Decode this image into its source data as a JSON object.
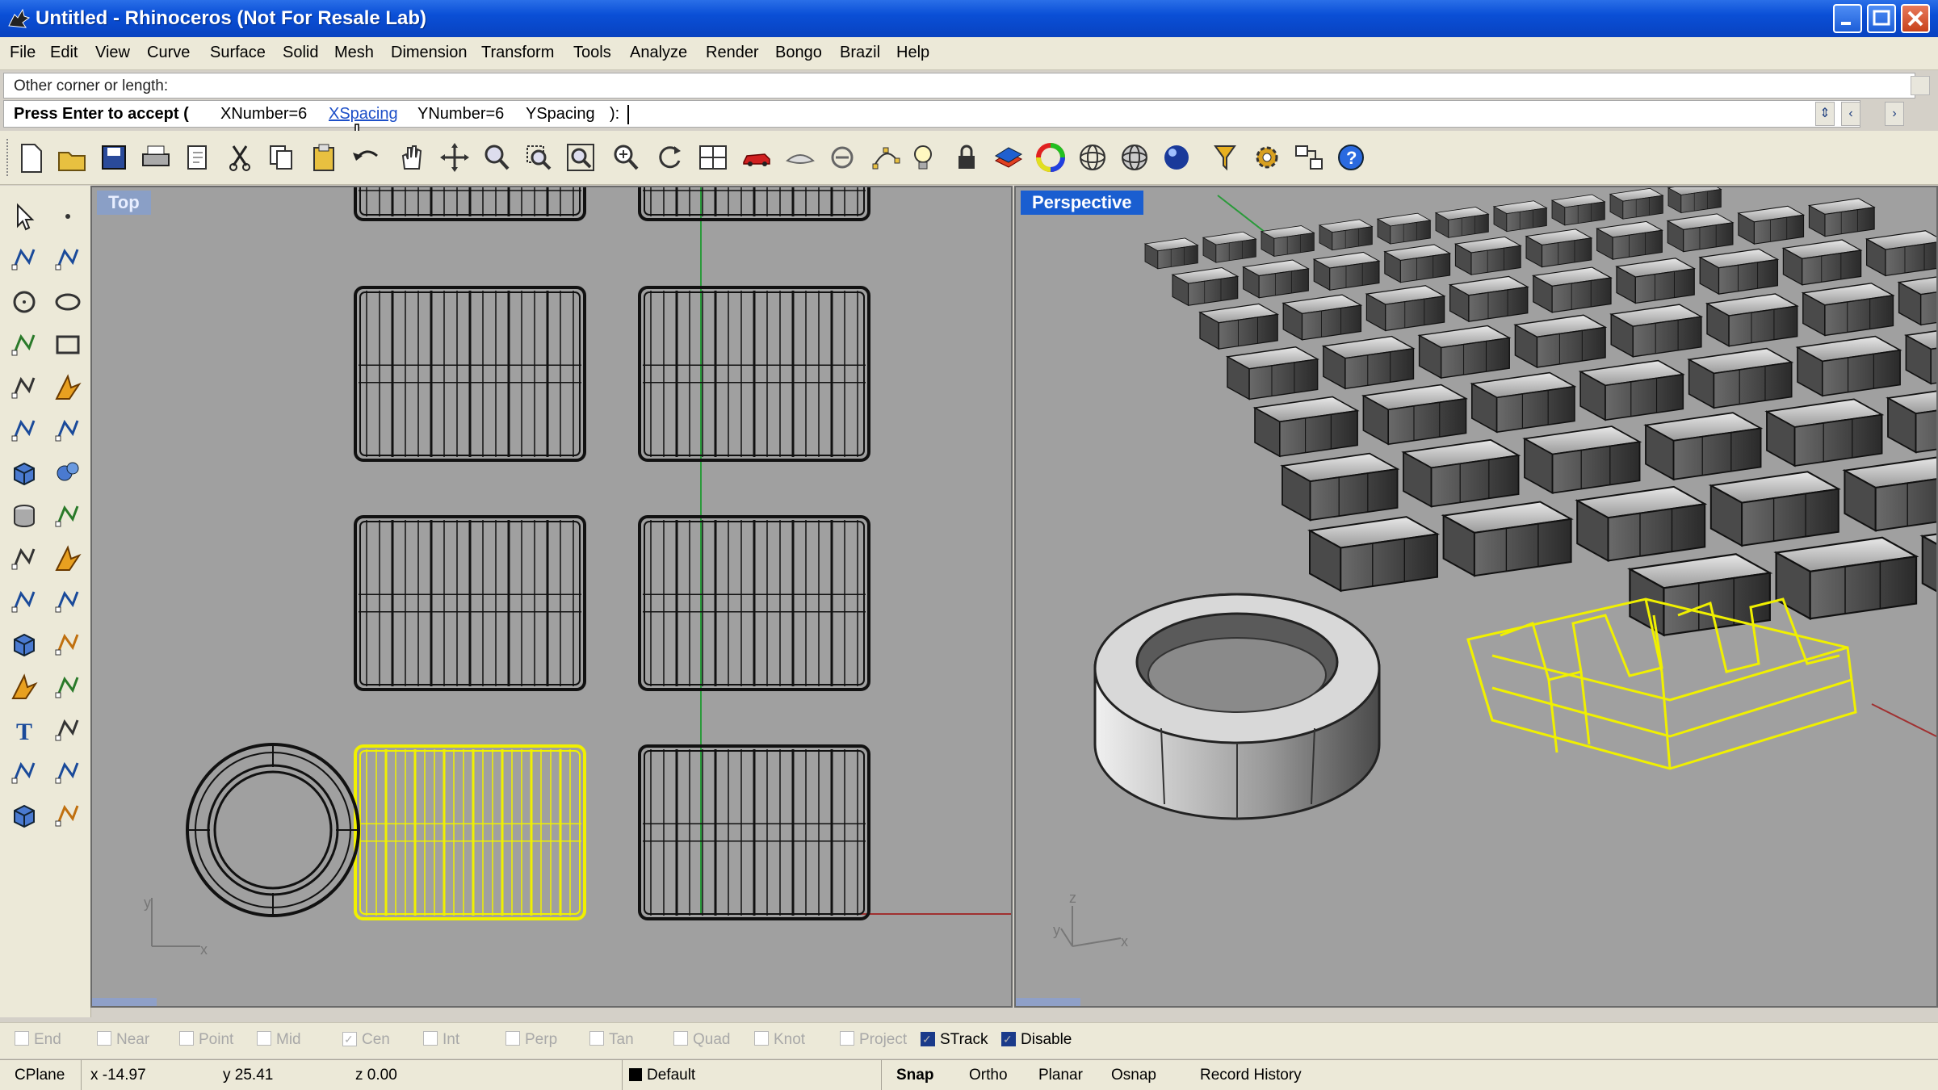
{
  "window": {
    "title": "Untitled - Rhinoceros (Not For Resale Lab)"
  },
  "menu": [
    "File",
    "Edit",
    "View",
    "Curve",
    "Surface",
    "Solid",
    "Mesh",
    "Dimension",
    "Transform",
    "Tools",
    "Analyze",
    "Render",
    "Bongo",
    "Brazil",
    "Help"
  ],
  "command": {
    "history": "Other corner or length:",
    "prompt": "Press Enter to accept (",
    "options": [
      "XNumber=6",
      "XSpacing",
      "YNumber=6",
      "YSpacing",
      "):"
    ]
  },
  "toolbar": {
    "icons": [
      "new-file-icon",
      "open-icon",
      "save-icon",
      "print-icon",
      "paste-properties-icon",
      "cut-icon",
      "copy-icon",
      "paste-icon",
      "undo-icon",
      "pan-icon",
      "move-view-icon",
      "zoom-icon",
      "zoom-window-icon",
      "zoom-extents-icon",
      "zoom-selected-icon",
      "rotate-view-icon",
      "four-viewports-icon",
      "car-icon",
      "hide-icon",
      "show-icon",
      "point-edit-icon",
      "light-icon",
      "lock-icon",
      "layer-icon",
      "color-wheel-icon",
      "wireframe-sphere-icon",
      "shaded-sphere-icon",
      "rendered-sphere-icon",
      "select-filter-icon",
      "options-gear-icon",
      "snap-options-icon",
      "help-icon"
    ]
  },
  "palette": {
    "icons": [
      "select-arrow-icon",
      "point-icon",
      "polyline-icon",
      "control-points-icon",
      "circle-icon",
      "ellipse-icon",
      "arc-icon",
      "rectangle-icon",
      "polygon-icon",
      "curve-fillet-icon",
      "surface-corner-icon",
      "revolve-icon",
      "box-icon",
      "sphere-icon",
      "cylinder-icon",
      "plane-surface-icon",
      "boolean-icon",
      "explode-icon",
      "trim-icon",
      "split-icon",
      "mesh-icon",
      "array-icon",
      "fillet-icon",
      "blend-icon",
      "text-icon",
      "scale-icon",
      "transform-icon",
      "dimension-icon",
      "solid-tools-icon",
      "mirror-icon"
    ]
  },
  "viewports": {
    "top_label": "Top",
    "perspective_label": "Perspective",
    "top_axes": {
      "x": "x",
      "y": "y"
    },
    "persp_axes": {
      "x": "x",
      "y": "y",
      "z": "z"
    }
  },
  "osnap": [
    {
      "label": "End",
      "checked": false
    },
    {
      "label": "Near",
      "checked": false
    },
    {
      "label": "Point",
      "checked": false
    },
    {
      "label": "Mid",
      "checked": false
    },
    {
      "label": "Cen",
      "checked": true
    },
    {
      "label": "Int",
      "checked": false
    },
    {
      "label": "Perp",
      "checked": false
    },
    {
      "label": "Tan",
      "checked": false
    },
    {
      "label": "Quad",
      "checked": false
    },
    {
      "label": "Knot",
      "checked": false
    },
    {
      "label": "Project",
      "checked": false
    },
    {
      "label": "STrack",
      "checked": true
    },
    {
      "label": "Disable",
      "checked": true
    }
  ],
  "status": {
    "cplane": "CPlane",
    "x": "x -14.97",
    "y": "y 25.41",
    "z": "z 0.00",
    "layer": "Default",
    "snap": "Snap",
    "ortho": "Ortho",
    "planar": "Planar",
    "osnap": "Osnap",
    "record_history": "Record History"
  },
  "colors": {
    "selected": "#f0f000",
    "viewport_bg": "#a0a0a0",
    "active_label": "#1a5ed0"
  }
}
